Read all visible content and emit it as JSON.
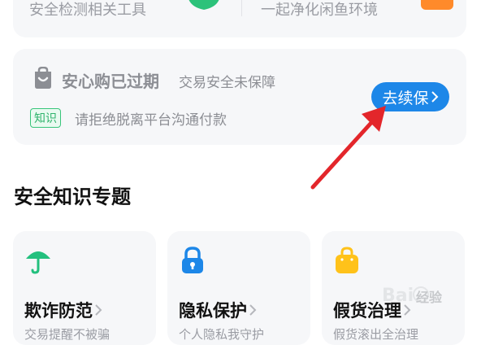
{
  "top_card": {
    "left_text": "安全检测相关工具",
    "right_text": "一起净化闲鱼环境"
  },
  "guard_card": {
    "title": "安心购已过期",
    "subtitle": "交易安全未保障",
    "tag": "知识",
    "note": "请拒绝脱离平台沟通付款",
    "renew_label": "去续保"
  },
  "section": {
    "title": "安全知识专题"
  },
  "topics": [
    {
      "label": "欺诈防范",
      "desc": "交易提醒不被骗",
      "icon": "umbrella-icon"
    },
    {
      "label": "隐私保护",
      "desc": "个人隐私我守护",
      "icon": "lock-icon"
    },
    {
      "label": "假货治理",
      "desc": "假货滚出全治理",
      "icon": "bag-icon"
    }
  ],
  "watermark": {
    "text": "经验"
  },
  "colors": {
    "accent_blue": "#1d87e8",
    "green": "#2fb36c",
    "red_arrow": "#e3262b",
    "orange": "#ff8a2a",
    "yellow": "#ffc21a"
  }
}
